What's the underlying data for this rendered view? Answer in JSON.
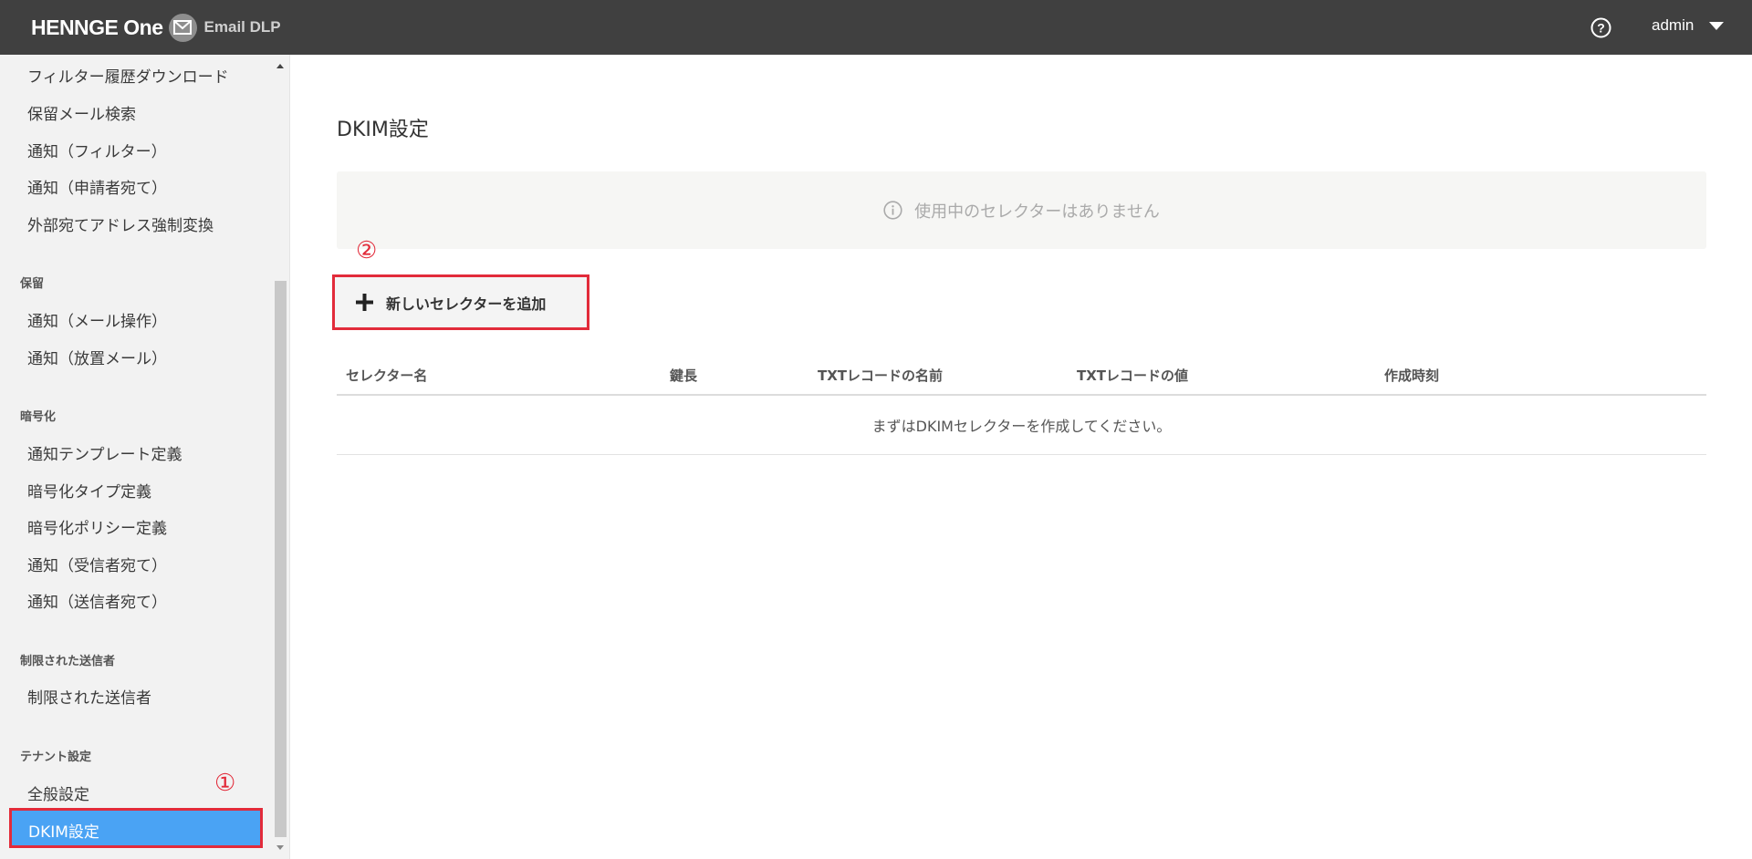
{
  "header": {
    "brand": "HENNGE One",
    "product": "Email DLP",
    "user": "admin",
    "help_icon": "question-circle-icon"
  },
  "sidebar": {
    "items_top": [
      "フィルター履歴ダウンロード",
      "保留メール検索",
      "通知（フィルター）",
      "通知（申請者宛て）",
      "外部宛てアドレス強制変換"
    ],
    "section_hold": "保留",
    "hold_items": [
      "通知（メール操作）",
      "通知（放置メール）"
    ],
    "section_encrypt": "暗号化",
    "encrypt_items": [
      "通知テンプレート定義",
      "暗号化タイプ定義",
      "暗号化ポリシー定義",
      "通知（受信者宛て）",
      "通知（送信者宛て）"
    ],
    "section_restricted": "制限された送信者",
    "restricted_items": [
      "制限された送信者"
    ],
    "section_tenant": "テナント設定",
    "tenant_items": [
      "全般設定"
    ],
    "active_item": "DKIM設定"
  },
  "markers": {
    "one": "①",
    "two": "②"
  },
  "main": {
    "title": "DKIM設定",
    "notice": "使用中のセレクターはありません",
    "add_button": "新しいセレクターを追加",
    "table": {
      "columns": [
        "セレクター名",
        "鍵長",
        "TXTレコードの名前",
        "TXTレコードの値",
        "作成時刻"
      ],
      "empty_message": "まずはDKIMセレクターを作成してください。"
    }
  },
  "colors": {
    "header_bg": "#404040",
    "sidebar_bg": "#f2f2f2",
    "active_bg": "#4aa3f4",
    "highlight_red": "#e22b3a"
  }
}
